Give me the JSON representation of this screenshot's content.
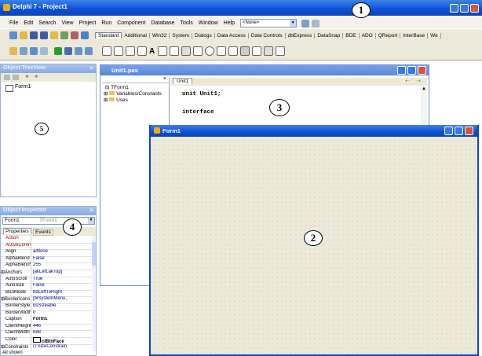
{
  "ide": {
    "title": "Delphi 7 - Project1",
    "menu": [
      "File",
      "Edit",
      "Search",
      "View",
      "Project",
      "Run",
      "Component",
      "Database",
      "Tools",
      "Window",
      "Help"
    ],
    "config_dropdown": "<None>",
    "palette_tabs": [
      "Standard",
      "Additional",
      "Win32",
      "System",
      "Dialogs",
      "Data Access",
      "Data Controls",
      "dbExpress",
      "DataSnap",
      "BDE",
      "ADO",
      "QReport",
      "InterBase",
      "We"
    ]
  },
  "tree_view": {
    "title": "Object TreeView",
    "root": "Form1"
  },
  "inspector": {
    "title": "Object Inspector",
    "object_name": "Form1",
    "object_type": "TForm1",
    "tabs": [
      "Properties",
      "Events"
    ],
    "properties": [
      {
        "name": "Action",
        "value": ""
      },
      {
        "name": "ActiveControl",
        "value": ""
      },
      {
        "name": "Align",
        "value": "alNone"
      },
      {
        "name": "AlphaBlend",
        "value": "False"
      },
      {
        "name": "AlphaBlendVal",
        "value": "255"
      },
      {
        "name": "⊞Anchors",
        "value": "[akLeft,akTop]"
      },
      {
        "name": "AutoScroll",
        "value": "True"
      },
      {
        "name": "AutoSize",
        "value": "False"
      },
      {
        "name": "BiDiMode",
        "value": "bdLeftToRight"
      },
      {
        "name": "⊞BorderIcons",
        "value": "[biSystemMenu,"
      },
      {
        "name": "BorderStyle",
        "value": "bsSizeable"
      },
      {
        "name": "BorderWidth",
        "value": "0"
      },
      {
        "name": "Caption",
        "value": "Form1"
      },
      {
        "name": "ClientHeight",
        "value": "446"
      },
      {
        "name": "ClientWidth",
        "value": "688"
      },
      {
        "name": "Color",
        "value": "clBtnFace"
      },
      {
        "name": "⊞Constraints",
        "value": "(TSizeConstrain"
      }
    ],
    "status": "All shown"
  },
  "editor": {
    "title": "Unit1.pas",
    "tab": "Unit1",
    "explorer_root": "TForm1",
    "explorer_items": [
      "Variables/Constants",
      "Uses"
    ],
    "code_lines": [
      "unit Unit1;",
      "interface"
    ]
  },
  "form": {
    "title": "Form1"
  },
  "markers": [
    "1",
    "2",
    "3",
    "4",
    "5"
  ]
}
